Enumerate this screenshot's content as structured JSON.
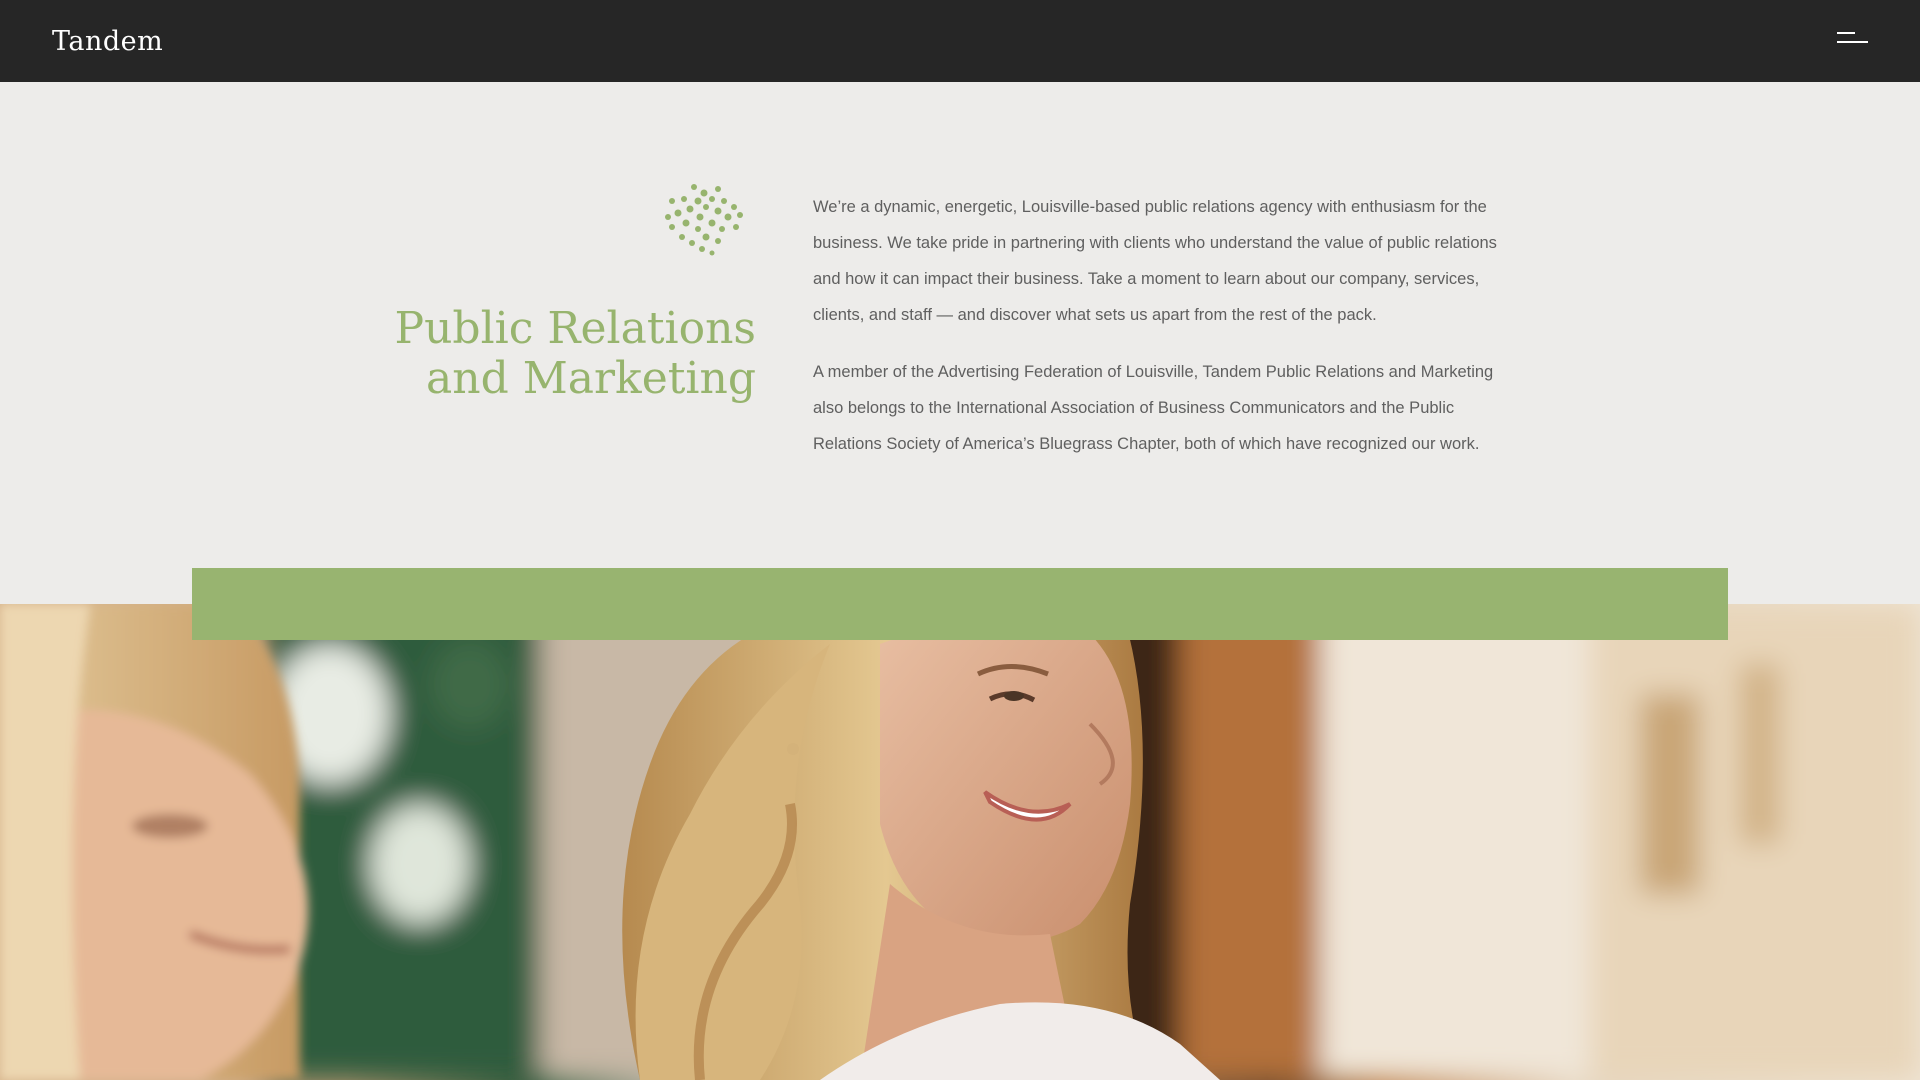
{
  "header": {
    "logo_text": "Tandem",
    "menu_icon": "hamburger-menu-icon"
  },
  "intro": {
    "emblem_icon": "green-dot-burst-icon",
    "headline_line1": "Public Relations",
    "headline_line2": "and Marketing",
    "paragraph1": "We’re a dynamic, energetic, Louisville-based public relations agency with enthusiasm for the business. We take pride in partnering with clients who understand the value of public relations and how it can impact their business. Take a moment to learn about our company, services, clients, and staff — and discover what sets us apart from the rest of the pack.",
    "paragraph2": "A member of the Advertising Federation of Louisville, Tandem Public Relations and Marketing also belongs to the International Association of Business Communicators and the Public Relations Society of America’s Bluegrass Chapter, both of which have recognized our work."
  },
  "colors": {
    "header_bg": "#262626",
    "page_bg": "#edecea",
    "accent_green": "#97b46e",
    "body_text": "#5f5f5f"
  }
}
